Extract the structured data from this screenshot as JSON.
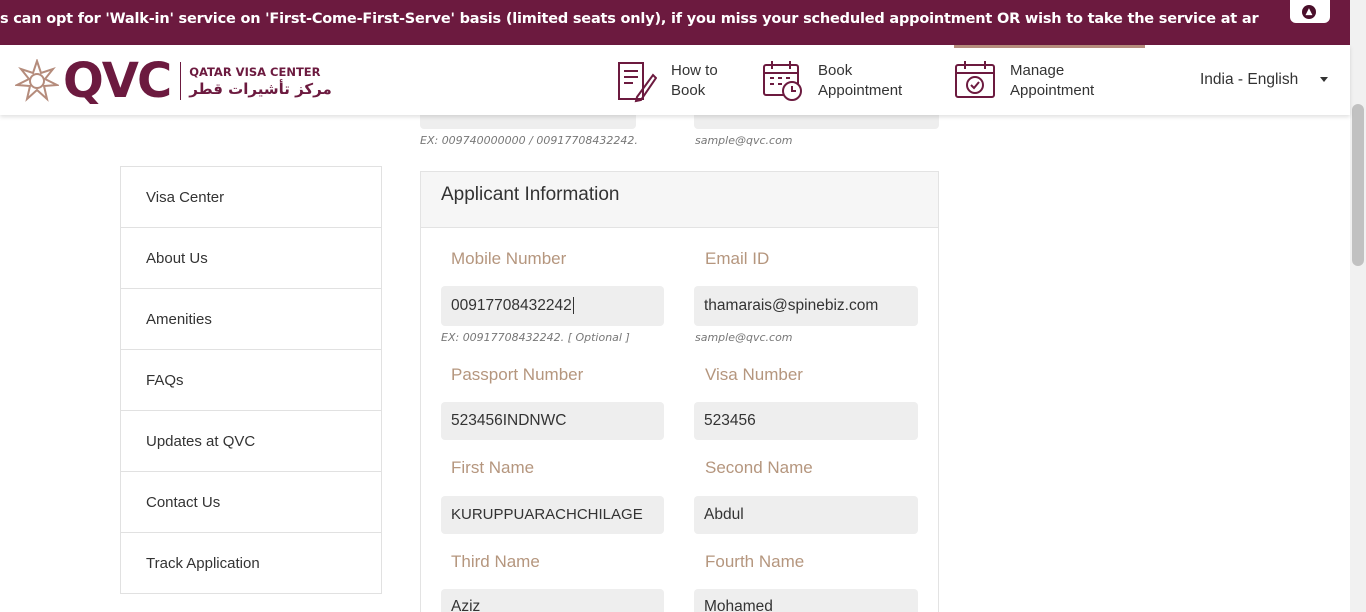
{
  "banner": {
    "text": "s can opt for 'Walk-in' service on 'First-Come-First-Serve' basis (limited seats only), if you miss your scheduled appointment OR wish to take the service at ar",
    "scroll_top_icon": "chevron-up-icon"
  },
  "header": {
    "logo_text": "QVC",
    "logo_en": "QATAR VISA CENTER",
    "logo_ar": "مركز تأشيرات قطر",
    "nav": [
      {
        "line1": "How to",
        "line2": "Book",
        "icon": "document-edit-icon"
      },
      {
        "line1": "Book",
        "line2": "Appointment",
        "icon": "calendar-clock-icon"
      },
      {
        "line1": "Manage",
        "line2": "Appointment",
        "icon": "calendar-check-icon"
      }
    ],
    "language": "India - English",
    "accent": "#6c1a3f"
  },
  "sidebar": {
    "items": [
      {
        "label": "Visa Center"
      },
      {
        "label": "About Us"
      },
      {
        "label": "Amenities"
      },
      {
        "label": "FAQs"
      },
      {
        "label": "Updates at QVC"
      },
      {
        "label": "Contact Us"
      },
      {
        "label": "Track Application"
      }
    ]
  },
  "previous_section": {
    "mobile_hint": "EX: 009740000000 / 00917708432242.",
    "email_hint": "sample@qvc.com"
  },
  "applicant": {
    "title": "Applicant Information",
    "mobile": {
      "label": "Mobile Number",
      "value": "00917708432242",
      "hint": "EX: 00917708432242. [ Optional ]"
    },
    "email": {
      "label": "Email ID",
      "value": "thamarais@spinebiz.com",
      "hint": "sample@qvc.com"
    },
    "passport": {
      "label": "Passport Number",
      "value": "523456INDNWC"
    },
    "visa": {
      "label": "Visa Number",
      "value": "523456"
    },
    "first_name": {
      "label": "First Name",
      "value": "KURUPPUARACHCHILAGE"
    },
    "second_name": {
      "label": "Second Name",
      "value": "Abdul"
    },
    "third_name": {
      "label": "Third Name",
      "value": "Aziz"
    },
    "fourth_name": {
      "label": "Fourth Name",
      "value": "Mohamed"
    }
  }
}
